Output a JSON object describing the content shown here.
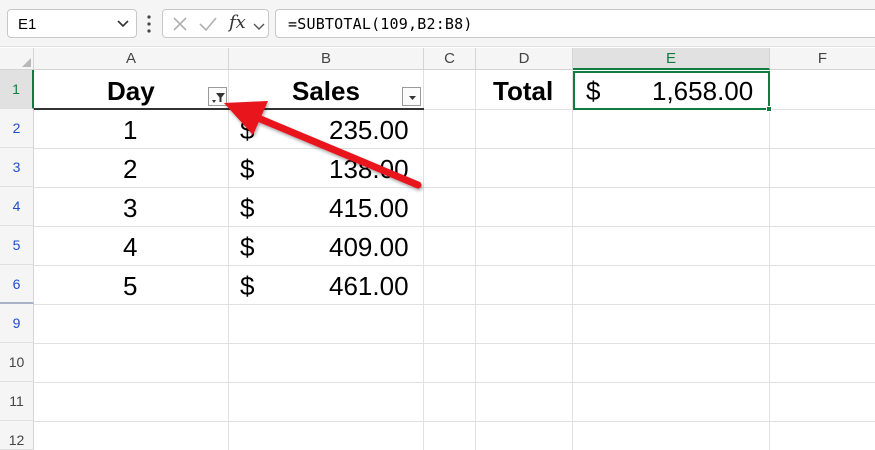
{
  "formula_bar": {
    "name_box": "E1",
    "fx_label": "fx",
    "formula": "=SUBTOTAL(109,B2:B8)"
  },
  "columns": [
    "A",
    "B",
    "C",
    "D",
    "E",
    "F"
  ],
  "selected_column": "E",
  "rows": [
    "1",
    "2",
    "3",
    "4",
    "5",
    "6",
    "9",
    "10",
    "11",
    "12"
  ],
  "selected_row": "1",
  "table": {
    "headers": {
      "day": "Day",
      "sales": "Sales"
    },
    "currency": "$",
    "data": [
      {
        "day": "1",
        "sales": "235.00"
      },
      {
        "day": "2",
        "sales": "138.00"
      },
      {
        "day": "3",
        "sales": "415.00"
      },
      {
        "day": "4",
        "sales": "409.00"
      },
      {
        "day": "5",
        "sales": "461.00"
      }
    ]
  },
  "total": {
    "label": "Total",
    "currency": "$",
    "value": "1,658.00"
  },
  "colors": {
    "selection": "#107c41",
    "row_header_filtered": "#1f4ec9",
    "annotation_arrow": "#e8141c"
  },
  "icons": [
    "chevron-down-icon",
    "more-vertical-icon",
    "cancel-icon",
    "enter-check-icon",
    "fx-icon",
    "filter-active-icon",
    "filter-dropdown-icon"
  ]
}
